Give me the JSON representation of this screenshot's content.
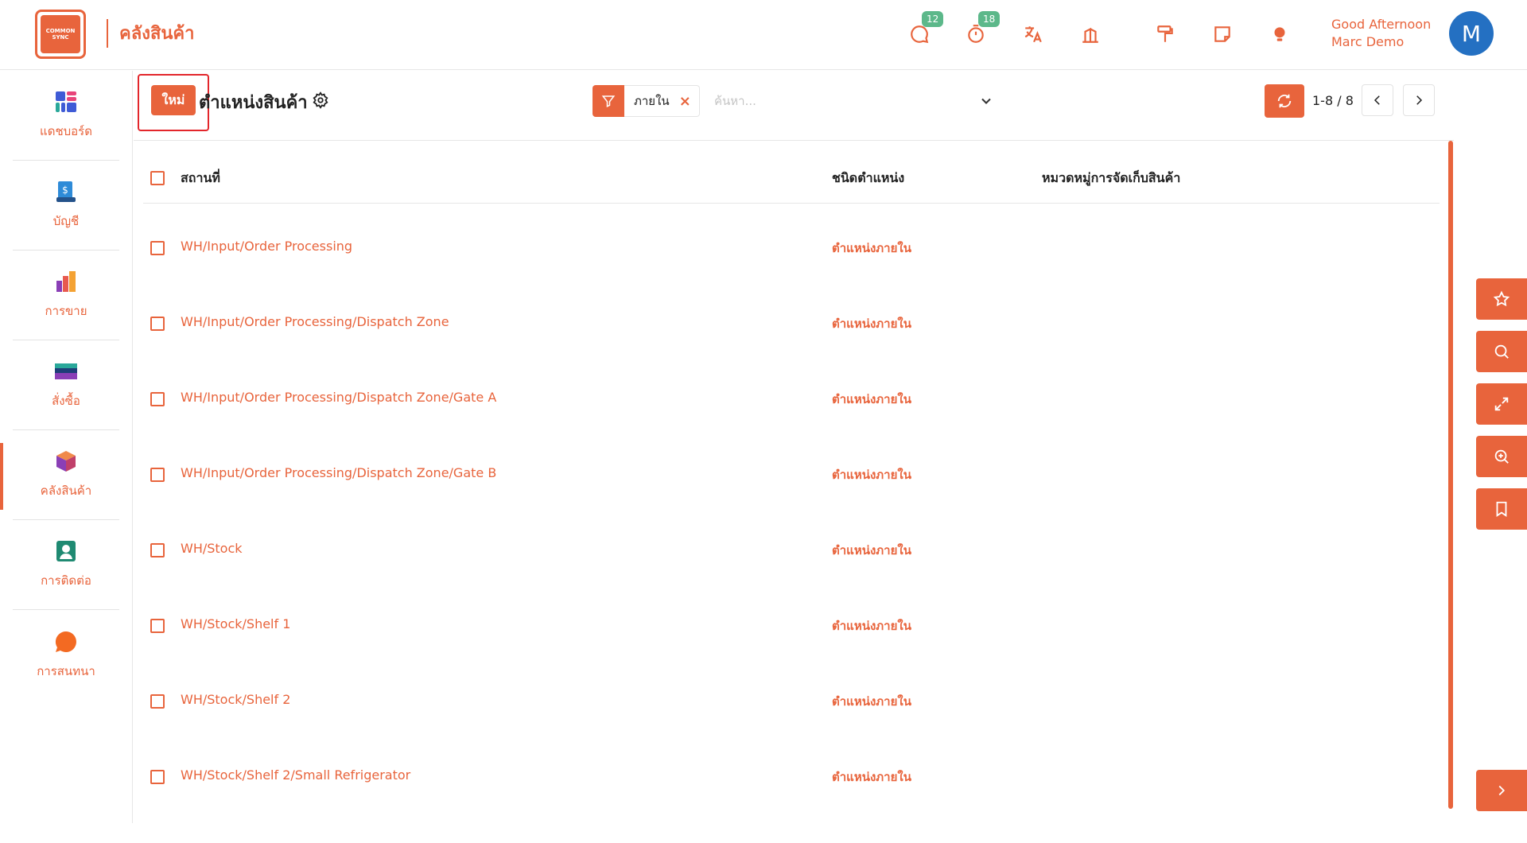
{
  "brand": {
    "logo_line1": "COMMON",
    "logo_line2": "SYNC",
    "app_title": "คลังสินค้า"
  },
  "header": {
    "chat_badge": "12",
    "timer_badge": "18",
    "greeting_line1": "Good Afternoon",
    "greeting_line2": "Marc Demo",
    "avatar_initial": "M",
    "icons": [
      "chat-icon",
      "timer-icon",
      "translate-icon",
      "building-icon",
      "paint-roller-icon",
      "note-icon",
      "lightbulb-icon"
    ]
  },
  "sidebar": {
    "items": [
      {
        "label": "แดชบอร์ด",
        "icon": "dashboard-icon"
      },
      {
        "label": "บัญชี",
        "icon": "accounting-icon"
      },
      {
        "label": "การขาย",
        "icon": "sales-icon"
      },
      {
        "label": "สั่งซื้อ",
        "icon": "purchase-icon"
      },
      {
        "label": "คลังสินค้า",
        "icon": "inventory-icon",
        "active": true
      },
      {
        "label": "การติดต่อ",
        "icon": "contacts-icon"
      },
      {
        "label": "การสนทนา",
        "icon": "discuss-icon"
      }
    ]
  },
  "controls": {
    "new_label": "ใหม่",
    "breadcrumb": "ตำแหน่งสินค้า",
    "filter_chip": "ภายใน",
    "search_placeholder": "ค้นหา...",
    "pager": "1-8 / 8"
  },
  "table": {
    "headers": {
      "location": "สถานที่",
      "type": "ชนิดตำแหน่ง",
      "category": "หมวดหมู่การจัดเก็บสินค้า"
    },
    "rows": [
      {
        "location": "WH/Input/Order Processing",
        "type": "ตำแหน่งภายใน"
      },
      {
        "location": "WH/Input/Order Processing/Dispatch Zone",
        "type": "ตำแหน่งภายใน"
      },
      {
        "location": "WH/Input/Order Processing/Dispatch Zone/Gate A",
        "type": "ตำแหน่งภายใน"
      },
      {
        "location": "WH/Input/Order Processing/Dispatch Zone/Gate B",
        "type": "ตำแหน่งภายใน"
      },
      {
        "location": "WH/Stock",
        "type": "ตำแหน่งภายใน"
      },
      {
        "location": "WH/Stock/Shelf 1",
        "type": "ตำแหน่งภายใน"
      },
      {
        "location": "WH/Stock/Shelf 2",
        "type": "ตำแหน่งภายใน"
      },
      {
        "location": "WH/Stock/Shelf 2/Small Refrigerator",
        "type": "ตำแหน่งภายใน"
      }
    ]
  },
  "floating_tools": [
    "star-icon",
    "search-icon",
    "expand-icon",
    "zoom-in-icon",
    "bookmark-icon"
  ],
  "colors": {
    "accent": "#e8643c",
    "badge": "#5cb88a",
    "avatar": "#2470c2",
    "highlight": "#e3262b"
  }
}
